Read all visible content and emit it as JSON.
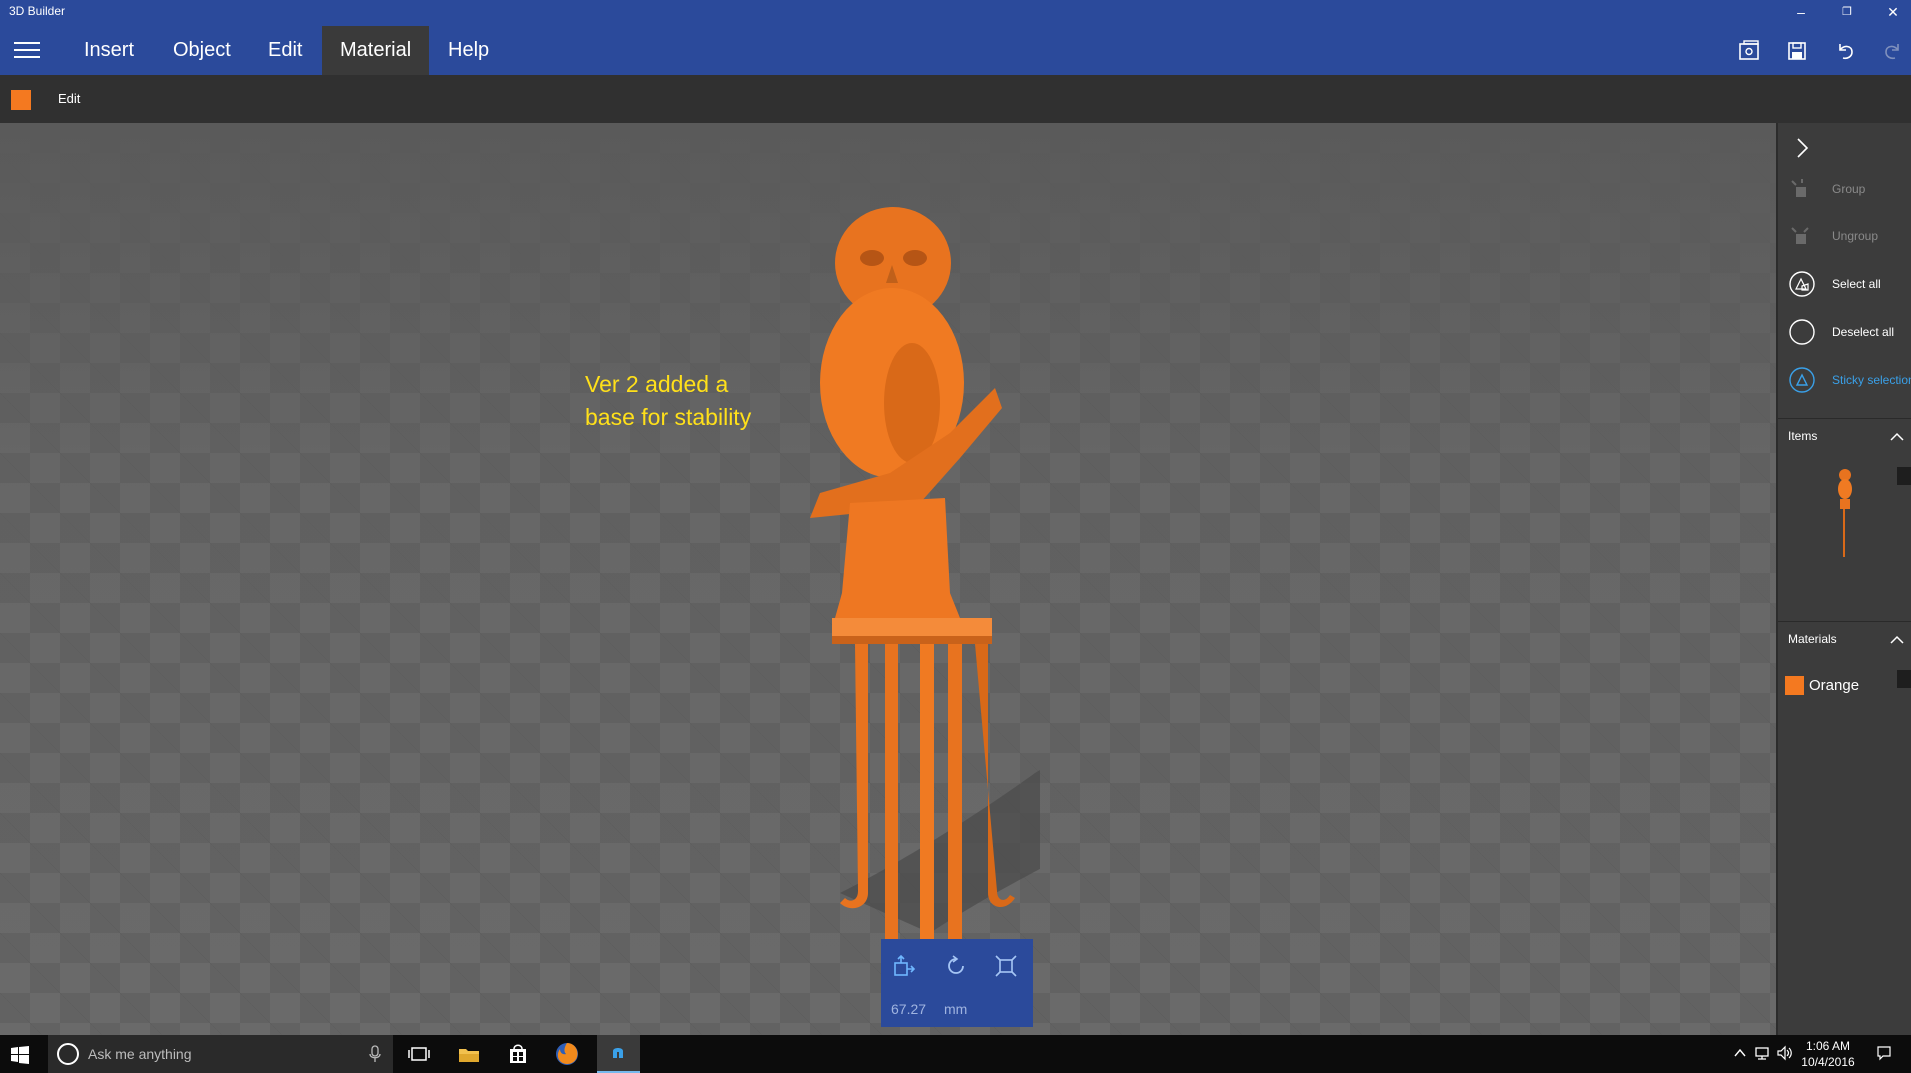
{
  "app": {
    "title": "3D Builder"
  },
  "window": {
    "minimize": "–",
    "restore": "❐",
    "close": "✕"
  },
  "menu": {
    "items": [
      {
        "label": "Insert"
      },
      {
        "label": "Object"
      },
      {
        "label": "Edit"
      },
      {
        "label": "Material"
      },
      {
        "label": "Help"
      }
    ],
    "active": "Material",
    "icons": [
      "3d-view-icon",
      "save-icon",
      "undo-icon",
      "redo-icon"
    ]
  },
  "context": {
    "label": "Edit",
    "swatch_color": "#f47920"
  },
  "viewport": {
    "annotation": "Ver 2 added a\nbase for stability",
    "model_color": "#f47920"
  },
  "transform_panel": {
    "value": "67.27",
    "unit": "mm",
    "icons": [
      "move-icon",
      "rotate-icon",
      "scale-icon"
    ]
  },
  "right_panel": {
    "commands": [
      {
        "label": "Group",
        "icon": "group-icon",
        "enabled": false
      },
      {
        "label": "Ungroup",
        "icon": "ungroup-icon",
        "enabled": false
      },
      {
        "label": "Select all",
        "icon": "select-all-icon",
        "enabled": true
      },
      {
        "label": "Deselect all",
        "icon": "deselect-all-icon",
        "enabled": true
      },
      {
        "label": "Sticky selection",
        "icon": "sticky-selection-icon",
        "enabled": true
      }
    ],
    "items_header": "Items",
    "materials_header": "Materials",
    "materials": [
      {
        "label": "Orange",
        "color": "#f47920"
      }
    ]
  },
  "taskbar": {
    "search_placeholder": "Ask me anything",
    "time": "1:06 AM",
    "date": "10/4/2016"
  },
  "colors": {
    "accent_blue": "#2b4a9b",
    "highlight_blue": "#3aa0e8",
    "annotation_yellow": "#ffe01a"
  }
}
